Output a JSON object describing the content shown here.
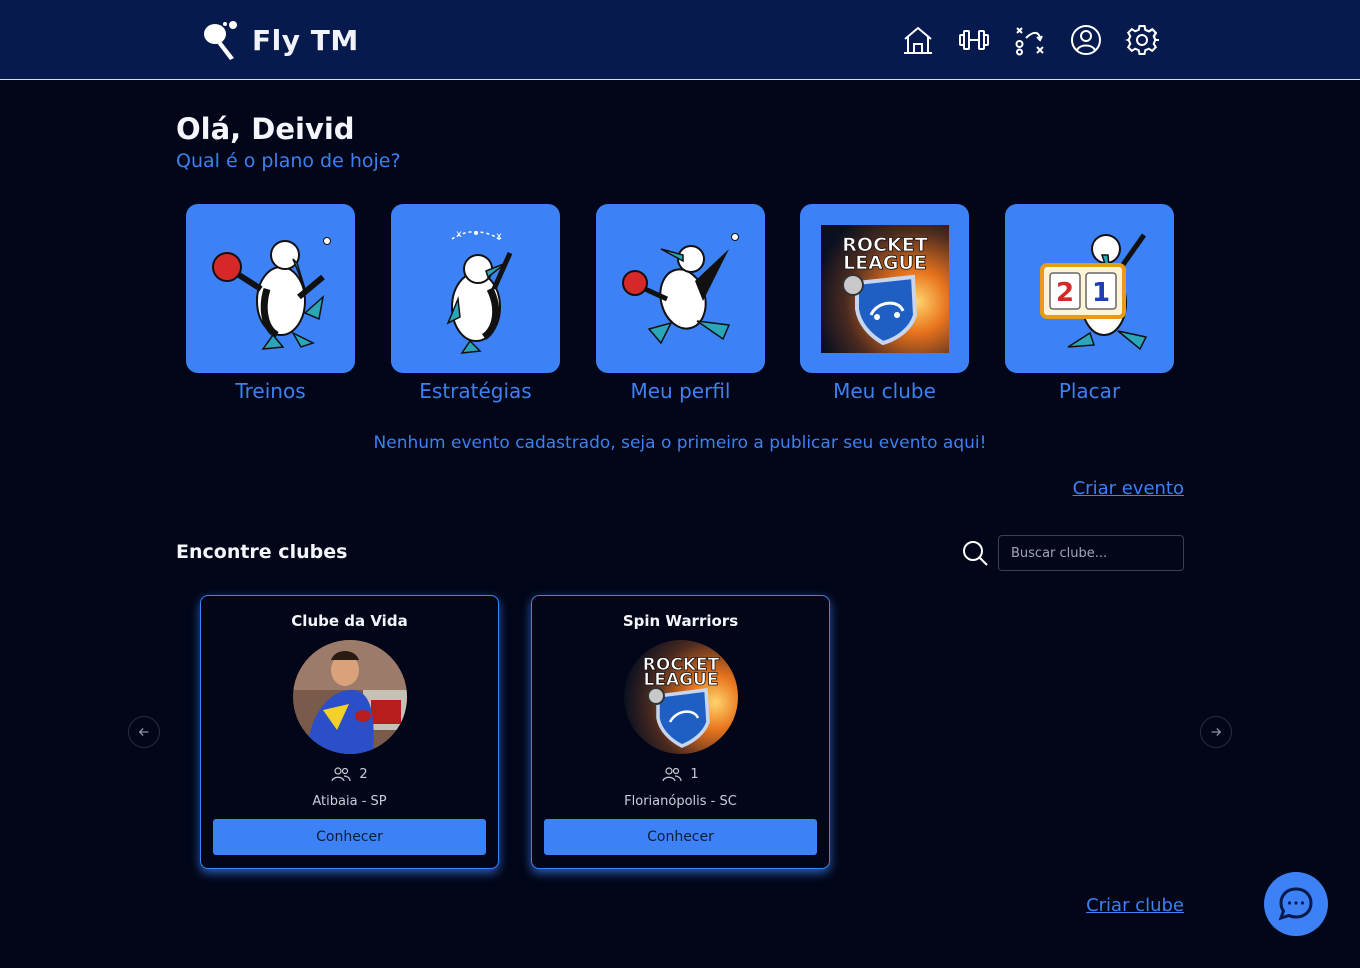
{
  "app": {
    "name": "Fly TM"
  },
  "nav": [
    {
      "icon": "home-icon"
    },
    {
      "icon": "dumbbell-icon"
    },
    {
      "icon": "tactics-icon"
    },
    {
      "icon": "user-icon"
    },
    {
      "icon": "gear-icon"
    }
  ],
  "greeting": {
    "title": "Olá, Deivid",
    "subtitle": "Qual é o plano de hoje?"
  },
  "tiles": [
    {
      "label": "Treinos",
      "image": "bird-ping-pong-illustration"
    },
    {
      "label": "Estratégias",
      "image": "bird-strategy-illustration"
    },
    {
      "label": "Meu perfil",
      "image": "bird-kicking-illustration"
    },
    {
      "label": "Meu clube",
      "image": "rocket-league-logo"
    },
    {
      "label": "Placar",
      "image": "bird-scoreboard-illustration",
      "score_left": "2",
      "score_right": "1"
    }
  ],
  "rocket_league_text": {
    "line1": "ROCKET",
    "line2": "LEAGUE"
  },
  "events": {
    "empty_message": "Nenhum evento cadastrado, seja o primeiro a publicar seu evento aqui!",
    "create_label": "Criar evento"
  },
  "clubs": {
    "title": "Encontre clubes",
    "search_placeholder": "Buscar clube...",
    "items": [
      {
        "name": "Clube da Vida",
        "members": "2",
        "location": "Atibaia - SP",
        "button": "Conhecer"
      },
      {
        "name": "Spin Warriors",
        "members": "1",
        "location": "Florianópolis - SC",
        "button": "Conhecer"
      }
    ],
    "create_label": "Criar clube"
  },
  "colors": {
    "background": "#020618",
    "header": "#061a4d",
    "accent": "#3c82f6"
  }
}
